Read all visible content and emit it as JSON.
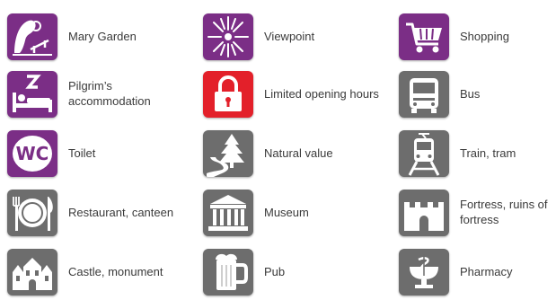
{
  "colors": {
    "purple": "#7b2e86",
    "gray": "#6d6d6d",
    "red": "#e3202a"
  },
  "items": [
    {
      "label": "Mary Garden",
      "icon": "mary-garden-icon"
    },
    {
      "label": "Viewpoint",
      "icon": "viewpoint-icon"
    },
    {
      "label": "Shopping",
      "icon": "shopping-cart-icon"
    },
    {
      "label": "Pilgrim’s accommodation",
      "icon": "bed-icon"
    },
    {
      "label": "Limited opening hours",
      "icon": "padlock-icon"
    },
    {
      "label": "Bus",
      "icon": "bus-icon"
    },
    {
      "label": "Toilet",
      "icon": "wc-icon"
    },
    {
      "label": "Natural value",
      "icon": "tree-road-icon"
    },
    {
      "label": "Train, tram",
      "icon": "train-icon"
    },
    {
      "label": "Restaurant, canteen",
      "icon": "plate-cutlery-icon"
    },
    {
      "label": "Museum",
      "icon": "museum-icon"
    },
    {
      "label": "Fortress, ruins of fortress",
      "icon": "fortress-icon"
    },
    {
      "label": "Castle, monument",
      "icon": "castle-icon"
    },
    {
      "label": "Pub",
      "icon": "beer-mug-icon"
    },
    {
      "label": "Pharmacy",
      "icon": "pharmacy-icon"
    }
  ]
}
